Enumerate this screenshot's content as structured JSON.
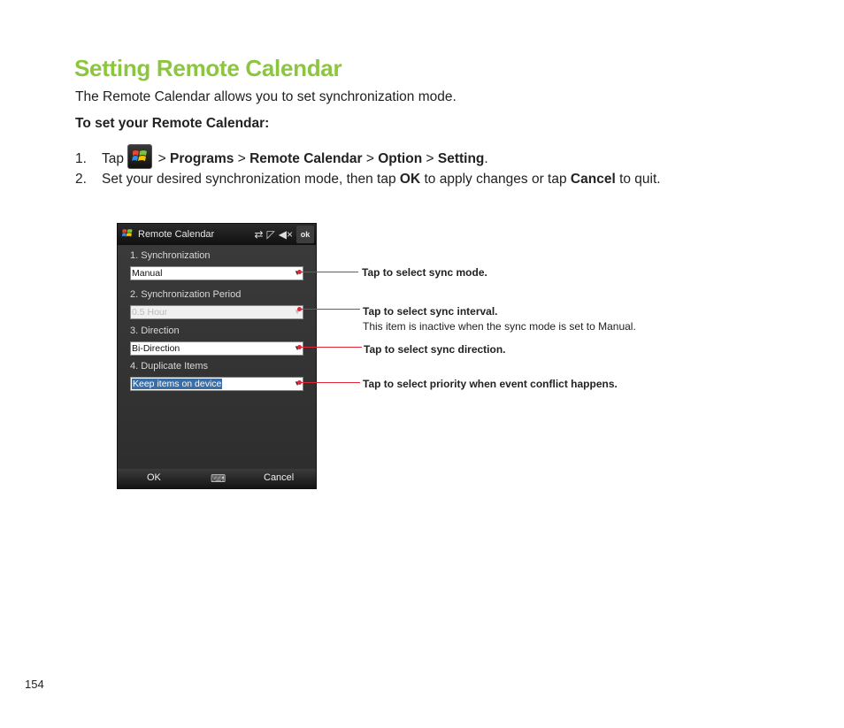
{
  "page": {
    "title": "Setting Remote Calendar",
    "intro": "The Remote Calendar allows you to set synchronization mode.",
    "subhead": "To set your Remote Calendar:",
    "page_number": "154"
  },
  "step1": {
    "num": "1.",
    "tap": "Tap",
    "gt1": ">",
    "programs": "Programs",
    "gt2": ">",
    "remote_calendar": "Remote Calendar",
    "gt3": ">",
    "option": "Option",
    "gt4": ">",
    "setting": "Setting",
    "period": "."
  },
  "step2": {
    "num": "2.",
    "text1": "Set your desired synchronization mode, then tap",
    "ok": "OK",
    "text2": "to apply changes or tap",
    "cancel": "Cancel",
    "text3": "to quit."
  },
  "phone": {
    "title": "Remote Calendar",
    "ok": "ok",
    "fields": [
      {
        "label": "1. Synchronization",
        "value": "Manual"
      },
      {
        "label": "2. Synchronization Period",
        "value": "0.5 Hour"
      },
      {
        "label": "3. Direction",
        "value": "Bi-Direction"
      },
      {
        "label": "4. Duplicate Items",
        "value": "Keep items on device"
      }
    ],
    "softkey_left": "OK",
    "softkey_right": "Cancel"
  },
  "callouts": {
    "sync_mode": "Tap to select sync mode.",
    "sync_interval": "Tap to select sync interval.",
    "sync_interval_note": "This item is inactive when the sync mode is set to Manual.",
    "sync_direction": "Tap to select sync direction.",
    "priority": "Tap to select priority when  event conflict happens."
  },
  "colors": {
    "title": "#8cc63f",
    "callout_line": "#e0273a"
  }
}
